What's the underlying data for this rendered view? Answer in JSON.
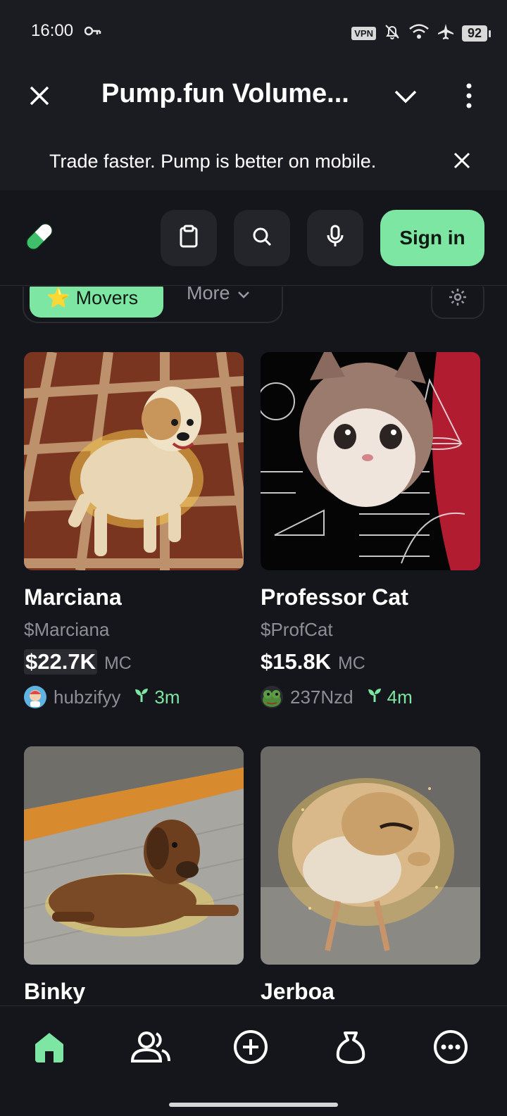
{
  "status_bar": {
    "time": "16:00",
    "vpn": "VPN",
    "battery": "92"
  },
  "header": {
    "title": "Pump.fun Volume..."
  },
  "banner": {
    "text": "Trade faster. Pump is better on mobile."
  },
  "toolbar": {
    "sign_in_label": "Sign in"
  },
  "filters": {
    "movers_label": "Movers",
    "movers_emoji": "⭐",
    "more_label": "More"
  },
  "cards": [
    {
      "name": "Marciana",
      "ticker": "$Marciana",
      "market_cap": "$22.7K",
      "mc_label": "MC",
      "creator": "hubzifyy",
      "age": "3m"
    },
    {
      "name": "Professor Cat",
      "ticker": "$ProfCat",
      "market_cap": "$15.8K",
      "mc_label": "MC",
      "creator": "237Nzd",
      "age": "4m"
    },
    {
      "name": "Binky"
    },
    {
      "name": "Jerboa"
    }
  ],
  "colors": {
    "accent": "#7ee6a3",
    "background": "#15161b",
    "surface": "#24252b",
    "muted_text": "#8e8f96"
  },
  "bottom_nav": {
    "items": [
      "home-icon",
      "users-icon",
      "plus-circle-icon",
      "bag-icon",
      "more-circle-icon"
    ],
    "active": "home-icon"
  }
}
